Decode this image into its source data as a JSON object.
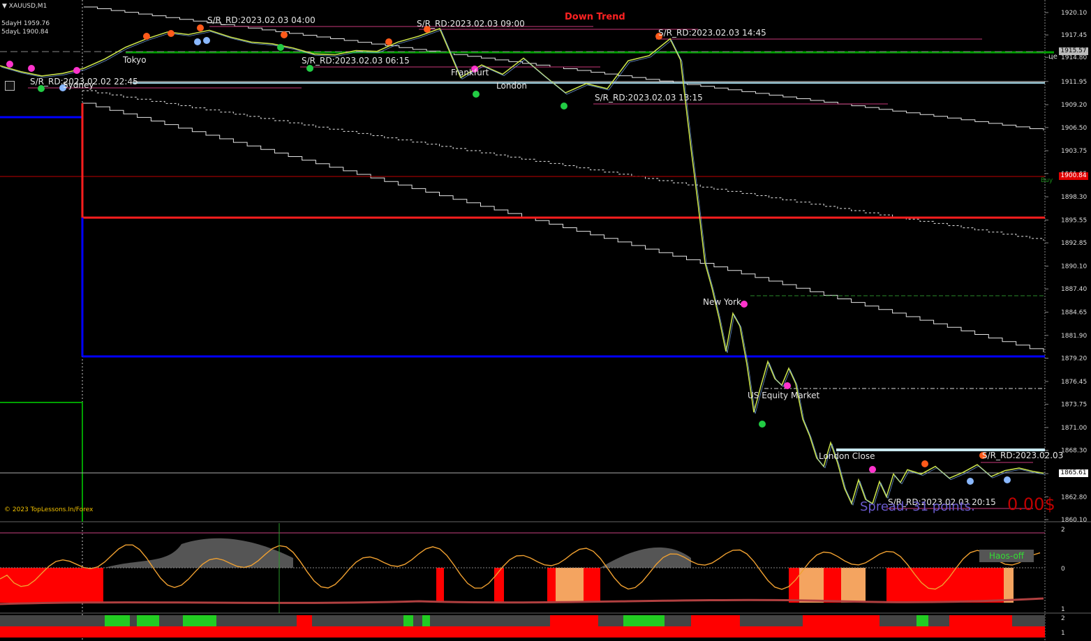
{
  "window": {
    "symbol": "XAUUSD,M1"
  },
  "header_info": {
    "five_day_high": "5dayH 1959.76",
    "five_day_low": "5dayL 1900.84"
  },
  "trend_label": "Down Trend",
  "copyright": "© 2023 TopLessons.In/Forex",
  "spread_text": "Spread: 31 points.",
  "profit_text": "0.00$",
  "indicator_label": "Haos-off",
  "buy_label": "Buy",
  "edge_label": "це",
  "sessions": {
    "tokyo": "Tokyo",
    "sydney": "Sydney",
    "frankfurt": "Frankfurt",
    "london": "London",
    "new_york": "New York",
    "us_equity": "US Equity Market",
    "london_close": "London Close"
  },
  "sr_labels": [
    "S/R_RD:2023.02.03 04:00",
    "S/R_RD:2023.02.03 09:00",
    "S/R_RD:2023.02.03 14:45",
    "S/R_RD:2023.02.03 06:15",
    "S/R_RD:2023.02.02 22:45",
    "S/R_RD:2023.02.03 13:15",
    "S/R_RD:2023.02.03",
    "S/R_RD:2023.02.03 20:15"
  ],
  "price_tags": {
    "top": "1915.57",
    "buy_line": "1900.84",
    "current": "1865.61"
  },
  "colors": {
    "up": "#7fb3ff",
    "down": "#c8e04a",
    "support": "#ff1e1e",
    "resistance": "#0000ff",
    "ma_green": "#00a000",
    "lower_red": "#ff0000",
    "lower_green": "#22cc22",
    "osc_line": "#f0a030"
  },
  "chart_data": [
    {
      "type": "line",
      "title": "XAUUSD,M1",
      "y_ticks": [
        "1920.10",
        "1917.45",
        "1914.80",
        "1911.95",
        "1909.20",
        "1906.50",
        "1903.75",
        "1901.05",
        "1898.30",
        "1895.55",
        "1892.85",
        "1890.10",
        "1887.40",
        "1884.65",
        "1881.90",
        "1879.20",
        "1876.45",
        "1873.75",
        "1871.00",
        "1868.30",
        "1865.55",
        "1862.80",
        "1860.10"
      ],
      "ylim": [
        1860.1,
        1920.1
      ],
      "x": [
        0,
        30,
        60,
        90,
        120,
        150,
        180,
        210,
        240,
        270,
        300,
        330,
        360,
        390,
        420,
        450,
        480,
        510,
        540,
        570,
        600,
        630,
        660,
        690,
        720,
        750,
        780,
        810,
        840,
        870,
        900,
        930,
        960,
        975,
        990,
        1000,
        1010,
        1020,
        1030,
        1040,
        1050,
        1060,
        1070,
        1080,
        1090,
        1100,
        1110,
        1120,
        1130,
        1140,
        1150,
        1160,
        1170,
        1180,
        1190,
        1200,
        1210,
        1220,
        1230,
        1240,
        1250,
        1260,
        1270,
        1280,
        1290,
        1300,
        1320,
        1340,
        1360,
        1380,
        1400,
        1420,
        1440,
        1460,
        1480,
        1495
      ],
      "series": [
        {
          "values": [
            1913.8,
            1913.1,
            1912.6,
            1912.9,
            1913.5,
            1914.6,
            1916.0,
            1917.0,
            1917.8,
            1917.5,
            1918.0,
            1917.2,
            1916.6,
            1916.4,
            1915.9,
            1915.2,
            1915.1,
            1915.6,
            1915.5,
            1916.6,
            1917.3,
            1918.2,
            1912.4,
            1913.9,
            1912.8,
            1914.7,
            1912.6,
            1910.6,
            1911.7,
            1911.1,
            1914.4,
            1915.0,
            1917.0,
            1914.5,
            1904.0,
            1897.5,
            1890.5,
            1887.5,
            1884.0,
            1880.0,
            1884.5,
            1883.0,
            1878.5,
            1872.8,
            1875.9,
            1878.8,
            1876.8,
            1876.0,
            1878.0,
            1876.2,
            1872.0,
            1870.0,
            1867.4,
            1866.4,
            1869.2,
            1866.8,
            1863.8,
            1862.0,
            1864.8,
            1862.5,
            1862.0,
            1864.6,
            1862.8,
            1865.5,
            1864.5,
            1866.0,
            1865.5,
            1866.4,
            1865.0,
            1865.7,
            1866.6,
            1865.2,
            1865.9,
            1866.2,
            1865.8,
            1865.6
          ]
        }
      ],
      "levels": {
        "five_day_high": 1959.76,
        "five_day_low": 1900.84,
        "support_red": 1895.7,
        "resistance_blue": 1879.2,
        "green_ma": 1915.0,
        "current": 1865.61
      }
    },
    {
      "type": "line",
      "y_ticks": [
        "2",
        "0",
        "1"
      ],
      "ylim": [
        -1,
        2
      ]
    },
    {
      "type": "bar",
      "y_ticks": [
        "2",
        "1"
      ],
      "ylim": [
        0,
        2
      ]
    }
  ]
}
